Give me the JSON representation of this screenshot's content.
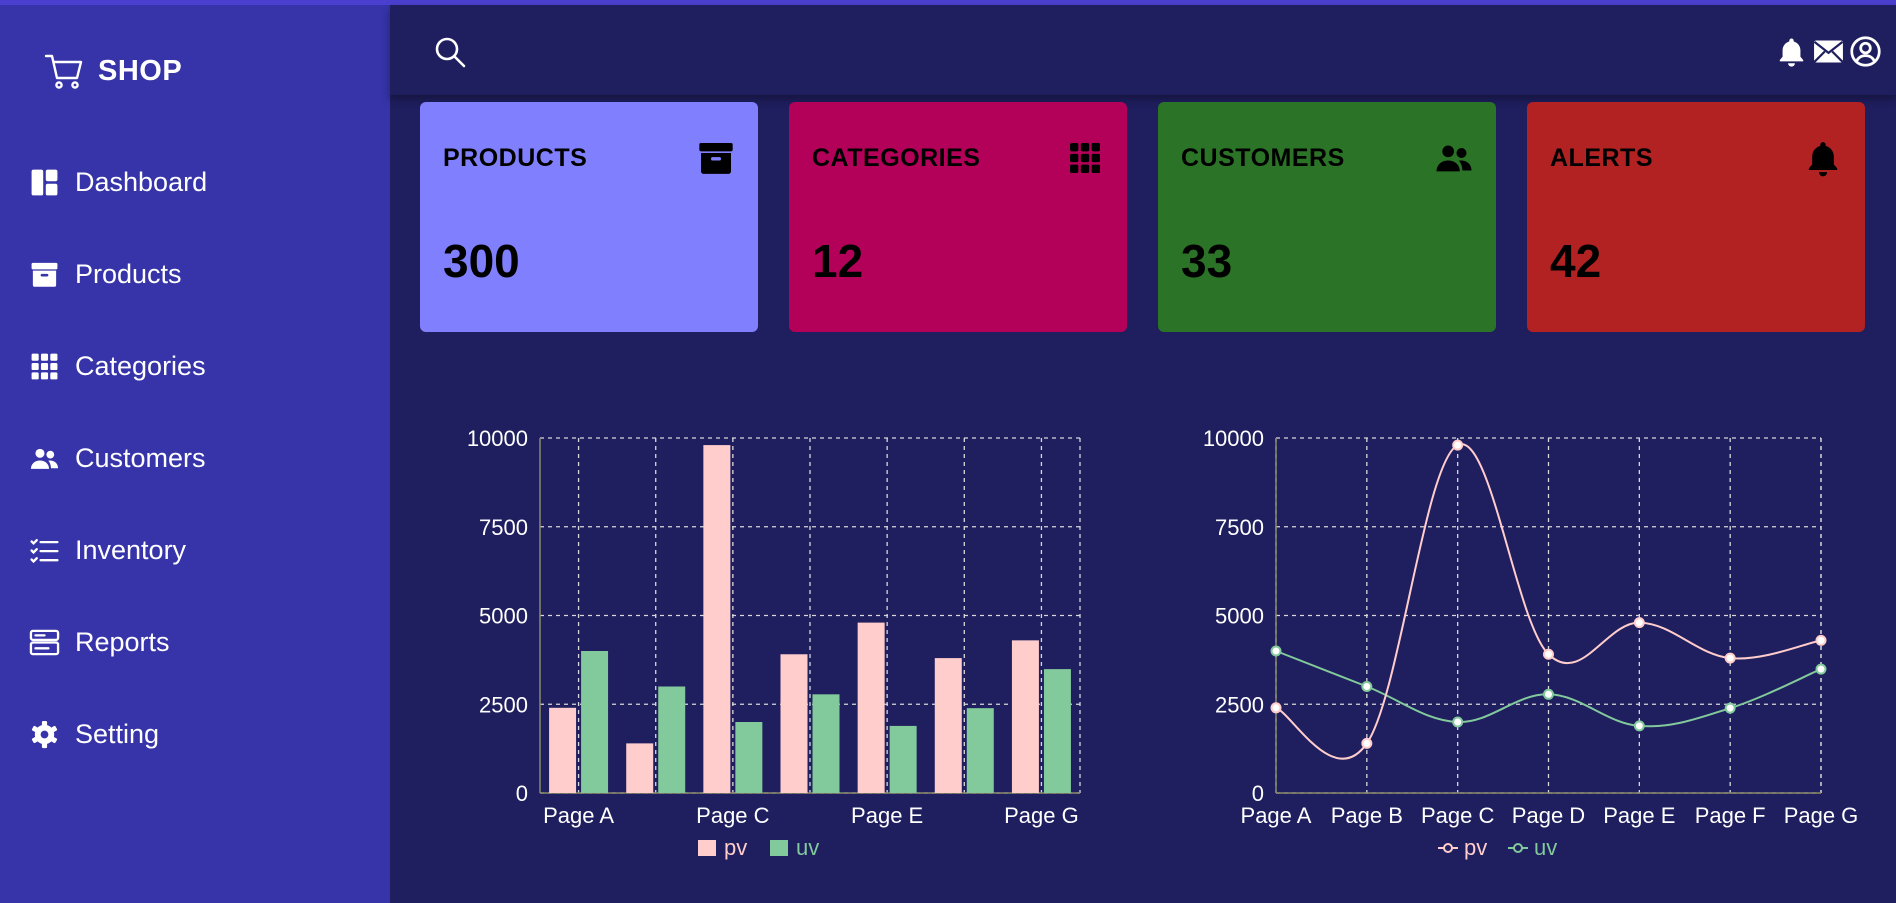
{
  "brand": {
    "name": "SHOP",
    "icon": "cart-icon"
  },
  "nav": [
    {
      "label": "Dashboard",
      "icon": "dashboard-icon"
    },
    {
      "label": "Products",
      "icon": "archive-icon"
    },
    {
      "label": "Categories",
      "icon": "grid-icon"
    },
    {
      "label": "Customers",
      "icon": "people-icon"
    },
    {
      "label": "Inventory",
      "icon": "checklist-icon"
    },
    {
      "label": "Reports",
      "icon": "report-icon"
    },
    {
      "label": "Setting",
      "icon": "gear-icon"
    }
  ],
  "header": {
    "icons": [
      "search-icon",
      "bell-icon",
      "mail-icon",
      "user-icon"
    ]
  },
  "cards": [
    {
      "title": "PRODUCTS",
      "value": "300",
      "color": "#8080ff",
      "icon": "archive-icon"
    },
    {
      "title": "CATEGORIES",
      "value": "12",
      "color": "#b30059",
      "icon": "grid-icon"
    },
    {
      "title": "CUSTOMERS",
      "value": "33",
      "color": "#2b7326",
      "icon": "people-icon"
    },
    {
      "title": "ALERTS",
      "value": "42",
      "color": "#b32222",
      "icon": "bell-icon"
    }
  ],
  "colors": {
    "pv": "#ffcdcb",
    "uv": "#82c99c",
    "grid": "#d8d8d8"
  },
  "chart_data": [
    {
      "type": "bar",
      "categories": [
        "Page A",
        "Page B",
        "Page C",
        "Page D",
        "Page E",
        "Page F",
        "Page G"
      ],
      "tick_labels_shown": [
        "Page A",
        "Page C",
        "Page E",
        "Page G"
      ],
      "series": [
        {
          "name": "pv",
          "values": [
            2400,
            1398,
            9800,
            3908,
            4800,
            3800,
            4300
          ]
        },
        {
          "name": "uv",
          "values": [
            4000,
            3000,
            2000,
            2780,
            1890,
            2390,
            3490
          ]
        }
      ],
      "yticks": [
        "0",
        "2500",
        "5000",
        "7500",
        "10000"
      ],
      "ylim": [
        0,
        10000
      ],
      "grid": true,
      "legend": "bottom"
    },
    {
      "type": "line",
      "categories": [
        "Page A",
        "Page B",
        "Page C",
        "Page D",
        "Page E",
        "Page F",
        "Page G"
      ],
      "series": [
        {
          "name": "pv",
          "values": [
            2400,
            1398,
            9800,
            3908,
            4800,
            3800,
            4300
          ]
        },
        {
          "name": "uv",
          "values": [
            4000,
            3000,
            2000,
            2780,
            1890,
            2390,
            3490
          ]
        }
      ],
      "yticks": [
        "0",
        "2500",
        "5000",
        "7500",
        "10000"
      ],
      "ylim": [
        0,
        10000
      ],
      "grid": true,
      "legend": "bottom"
    }
  ]
}
